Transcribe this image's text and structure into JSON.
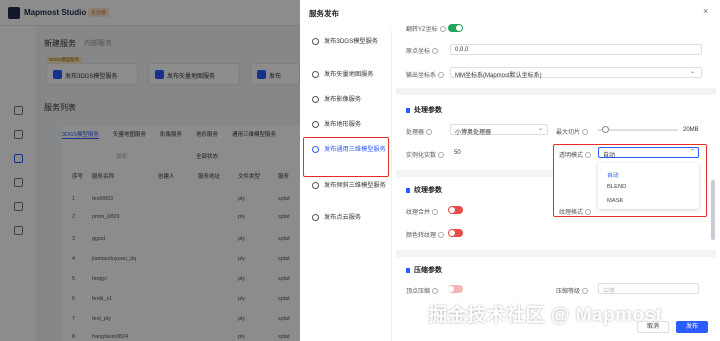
{
  "app": {
    "name": "Mapmost Studio",
    "version_badge": "企业版"
  },
  "background": {
    "new_service_title": "新建服务",
    "new_service_tab2": "内部服务",
    "badge": "3DGS模型服务",
    "cards": [
      "发布3DGS模型服务",
      "发布矢量地图服务",
      "发布"
    ],
    "list_title": "服务列表",
    "tabs": [
      "3DGS模型服务",
      "矢量地图服务",
      "影像服务",
      "地形服务",
      "通用三维模型服务"
    ],
    "filter_value": "全部状态",
    "search_placeholder": "搜索",
    "columns": [
      "序号",
      "服务名称",
      "创建人",
      "服务地址",
      "文件类型",
      "服务"
    ],
    "rows": [
      [
        "1",
        "test0003",
        "",
        "",
        "ply",
        "splat"
      ],
      [
        "2",
        "pmm_0829",
        "",
        "",
        "ply",
        "splat"
      ],
      [
        "3",
        "ggsst",
        "",
        "",
        "ply",
        "splat"
      ],
      [
        "4",
        "jiamiaoliuyuan_dq",
        "",
        "",
        "ply",
        "splat"
      ],
      [
        "5",
        "fangyi",
        "",
        "",
        "ply",
        "splat"
      ],
      [
        "6",
        "fenlii_s1",
        "",
        "",
        "ply",
        "splat"
      ],
      [
        "7",
        "test_ply",
        "",
        "",
        "ply",
        "splat"
      ],
      [
        "8",
        "hangfaxin0824",
        "",
        "",
        "ply",
        "splat"
      ]
    ]
  },
  "drawer": {
    "title": "服务发布",
    "close": "×",
    "sidebar": [
      "发布3DGS模型服务",
      "发布矢量地图服务",
      "发布影像服务",
      "发布地形服务",
      "发布通用三维模型服务",
      "发布倾斜三维模型服务",
      "发布点云服务"
    ],
    "fields": {
      "flip_yz_label": "翻转YZ坐标",
      "origin_label": "原点坐标",
      "origin_value": "0,0,0",
      "output_crs_label": "输出坐标系",
      "output_crs_value": "MM坐标系(Mapmost默认坐标系)"
    },
    "processing": {
      "title": "处理参数",
      "processor_label": "处理器",
      "processor_value": "小博奥处理器",
      "max_tile_label": "最大切片",
      "max_tile_value": "20MB",
      "instance_label": "实例化实数",
      "instance_value": "50",
      "transparency_label": "透明模式",
      "transparency_value": "自动",
      "transparency_options": [
        "自动",
        "BLEND",
        "MASK"
      ]
    },
    "texture": {
      "title": "纹理参数",
      "merge_label": "纹理合并",
      "color_label": "颜色转纹理",
      "format_label": "纹理格式"
    },
    "compression": {
      "title": "压缩参数",
      "vertex_label": "顶点压缩",
      "level_label": "压缩等级",
      "level_value": "中等"
    },
    "cancel": "取消",
    "publish": "发布"
  },
  "watermark": "掘金技术社区 @ Mapmost"
}
